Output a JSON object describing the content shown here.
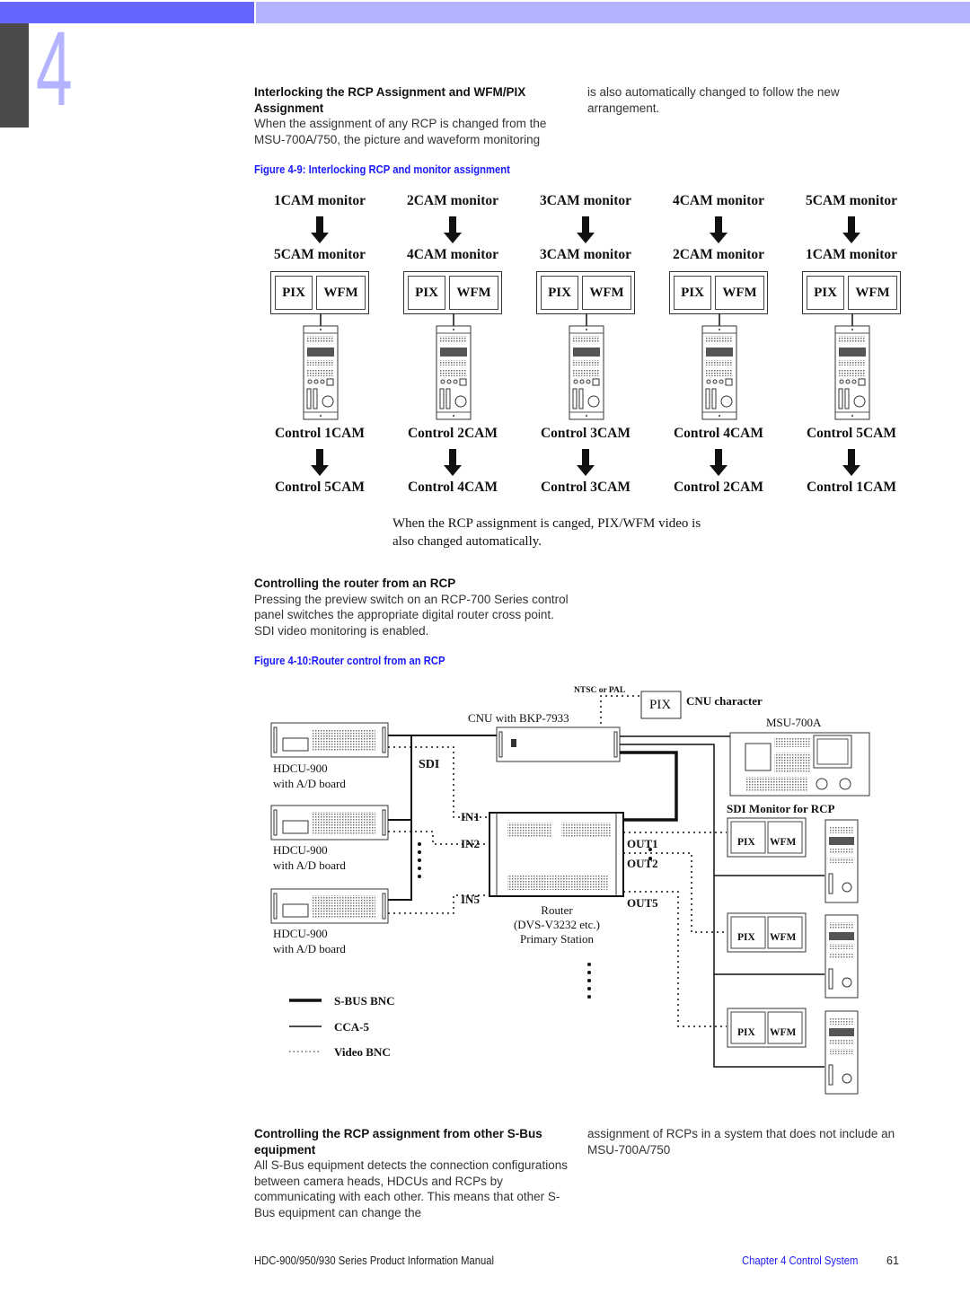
{
  "header": {
    "chapter_number": "4",
    "colors": {
      "bar_dark": "#6666ff",
      "bar_light": "#b3b3ff",
      "chapter_tab": "#4a4a4a",
      "link_blue": "#1a1aff"
    }
  },
  "section1": {
    "heading": "Interlocking the RCP Assignment and WFM/PIX Assignment",
    "body_left": "When the assignment of any RCP is changed from the MSU-700A/750, the picture and waveform monitoring",
    "body_right": "is also automatically changed to follow the new arrangement."
  },
  "figure9": {
    "caption": "Figure 4-9: Interlocking RCP and monitor assignment",
    "columns": [
      {
        "monitor_from": "1CAM monitor",
        "monitor_to": "5CAM monitor",
        "pix": "PIX",
        "wfm": "WFM",
        "control_from": "Control 1CAM",
        "control_to": "Control 5CAM"
      },
      {
        "monitor_from": "2CAM monitor",
        "monitor_to": "4CAM monitor",
        "pix": "PIX",
        "wfm": "WFM",
        "control_from": "Control 2CAM",
        "control_to": "Control 4CAM"
      },
      {
        "monitor_from": "3CAM monitor",
        "monitor_to": "3CAM monitor",
        "pix": "PIX",
        "wfm": "WFM",
        "control_from": "Control 3CAM",
        "control_to": "Control 3CAM"
      },
      {
        "monitor_from": "4CAM monitor",
        "monitor_to": "2CAM monitor",
        "pix": "PIX",
        "wfm": "WFM",
        "control_from": "Control 4CAM",
        "control_to": "Control 2CAM"
      },
      {
        "monitor_from": "5CAM monitor",
        "monitor_to": "1CAM monitor",
        "pix": "PIX",
        "wfm": "WFM",
        "control_from": "Control 5CAM",
        "control_to": "Control 1CAM"
      }
    ],
    "note_line1": "When the RCP assignment is canged, PIX/WFM video is",
    "note_line2": "also changed automatically."
  },
  "section2": {
    "heading": "Controlling the router from an RCP",
    "body": "Pressing the preview switch on an RCP-700 Series control panel switches the appropriate digital router cross point. SDI video monitoring is enabled."
  },
  "figure10": {
    "caption": "Figure 4-10:Router control from an RCP",
    "ntsc_pal": "NTSC or PAL",
    "pix_box": "PIX",
    "cnu_character": "CNU character",
    "cnu_label": "CNU with BKP-7933",
    "msu_label": "MSU-700A",
    "hdcu": [
      {
        "line1": "HDCU-900",
        "line2": "with A/D board"
      },
      {
        "line1": "HDCU-900",
        "line2": "with A/D board"
      },
      {
        "line1": "HDCU-900",
        "line2": "with A/D board"
      }
    ],
    "sdi": "SDI",
    "inputs": [
      "IN1",
      "IN2",
      "IN5"
    ],
    "outputs": [
      "OUT1",
      "OUT2",
      "OUT5"
    ],
    "router_line1": "Router",
    "router_line2": "(DVS-V3232 etc.)",
    "router_line3": "Primary Station",
    "sdi_monitor_label": "SDI Monitor for RCP",
    "monitors": [
      {
        "pix": "PIX",
        "wfm": "WFM"
      },
      {
        "pix": "PIX",
        "wfm": "WFM"
      },
      {
        "pix": "PIX",
        "wfm": "WFM"
      }
    ],
    "legend": [
      {
        "style": "thick",
        "label": "S-BUS BNC"
      },
      {
        "style": "thin",
        "label": "CCA-5"
      },
      {
        "style": "dotted",
        "label": "Video BNC"
      }
    ]
  },
  "section3": {
    "heading": "Controlling the RCP assignment from other S-Bus equipment",
    "body_left": "All S-Bus equipment detects the connection configurations between camera heads, HDCUs and RCPs by communicating with each other. This means that other S-Bus equipment can change the",
    "body_right": "assignment of RCPs in a system that does not include an MSU-700A/750"
  },
  "footer": {
    "manual_title": "HDC-900/950/930 Series Product Information Manual",
    "chapter_link": "Chapter 4 Control System",
    "page_number": "61"
  }
}
